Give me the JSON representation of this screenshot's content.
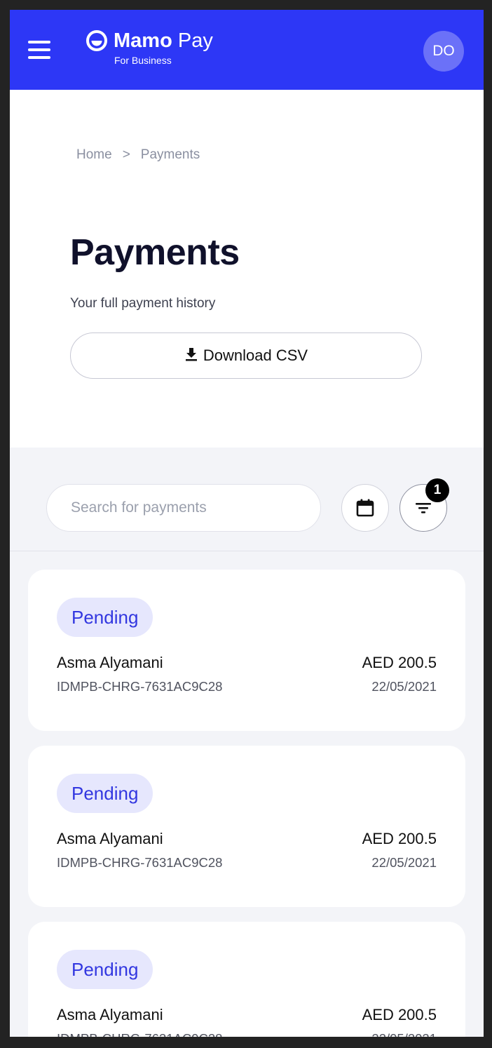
{
  "header": {
    "brand_bold": "Mamo",
    "brand_light": "Pay",
    "brand_sub": "For Business",
    "avatar_initials": "DO"
  },
  "breadcrumb": {
    "home": "Home",
    "separator": ">",
    "current": "Payments"
  },
  "page": {
    "title": "Payments",
    "subtitle": "Your full payment history",
    "download_label": "Download CSV"
  },
  "search": {
    "placeholder": "Search for payments",
    "value": "",
    "filter_count": "1"
  },
  "payments": [
    {
      "status": "Pending",
      "name": "Asma Alyamani",
      "id": "IDMPB-CHRG-7631AC9C28",
      "amount": "AED 200.5",
      "date": "22/05/2021"
    },
    {
      "status": "Pending",
      "name": "Asma Alyamani",
      "id": "IDMPB-CHRG-7631AC9C28",
      "amount": "AED 200.5",
      "date": "22/05/2021"
    },
    {
      "status": "Pending",
      "name": "Asma Alyamani",
      "id": "IDMPB-CHRG-7631AC9C28",
      "amount": "AED 200.5",
      "date": "22/05/2021"
    }
  ],
  "icons": {
    "menu": "menu-icon",
    "logo": "mamo-logo-icon",
    "download": "download-icon",
    "calendar": "calendar-icon",
    "filter": "filter-icon"
  },
  "colors": {
    "brand": "#2d37f6",
    "avatar": "#6b71f8",
    "pending_bg": "#e6e7fd",
    "pending_text": "#3237e0",
    "page_bg": "#f3f4f8"
  }
}
